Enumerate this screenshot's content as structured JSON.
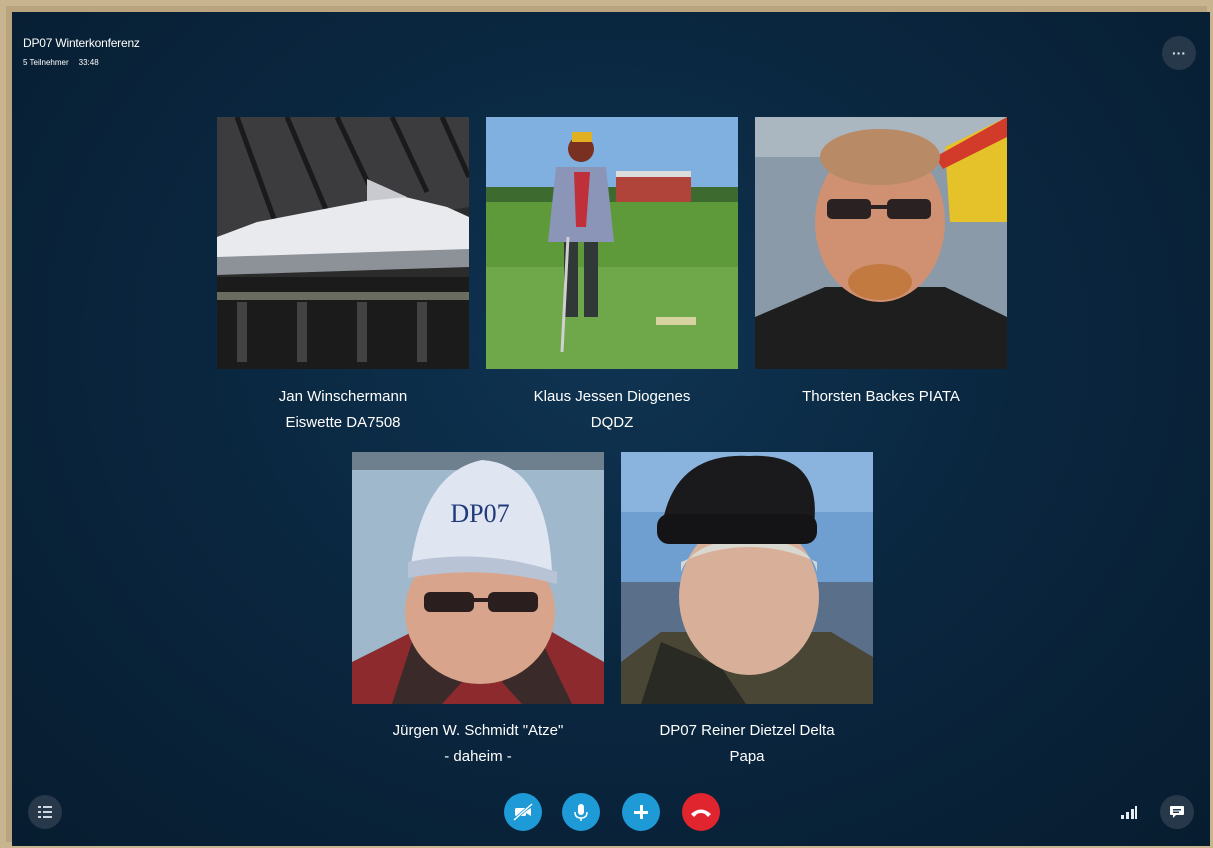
{
  "call": {
    "title": "DP07 Winterkonferenz",
    "participants_count": "5 Teilnehmer",
    "duration": "33:48"
  },
  "participants": [
    {
      "line1": "Jan Winschermann",
      "line2": "Eiswette DA7508",
      "avatar": "space-shuttle-photo"
    },
    {
      "line1": "Klaus Jessen Diogenes",
      "line2": "DQDZ",
      "avatar": "person-in-field-photo"
    },
    {
      "line1": "Thorsten Backes PIATA",
      "line2": "",
      "avatar": "man-with-sunglasses-photo"
    },
    {
      "line1": "Jürgen W. Schmidt \"Atze\"",
      "line2": "- daheim -",
      "avatar": "man-with-cap-photo"
    },
    {
      "line1": "DP07 Reiner Dietzel  Delta",
      "line2": "Papa",
      "avatar": "man-with-beanie-photo"
    }
  ],
  "controls": {
    "video_icon": "video-off-icon",
    "mic_icon": "microphone-icon",
    "add_icon": "add-icon",
    "hangup_icon": "hang-up-icon",
    "accent_color": "#1e9ad6",
    "hangup_color": "#e0252e"
  },
  "icons": {
    "more": "more-options-icon",
    "menu": "menu-list-icon",
    "signal": "signal-strength-icon",
    "chat": "chat-icon"
  }
}
